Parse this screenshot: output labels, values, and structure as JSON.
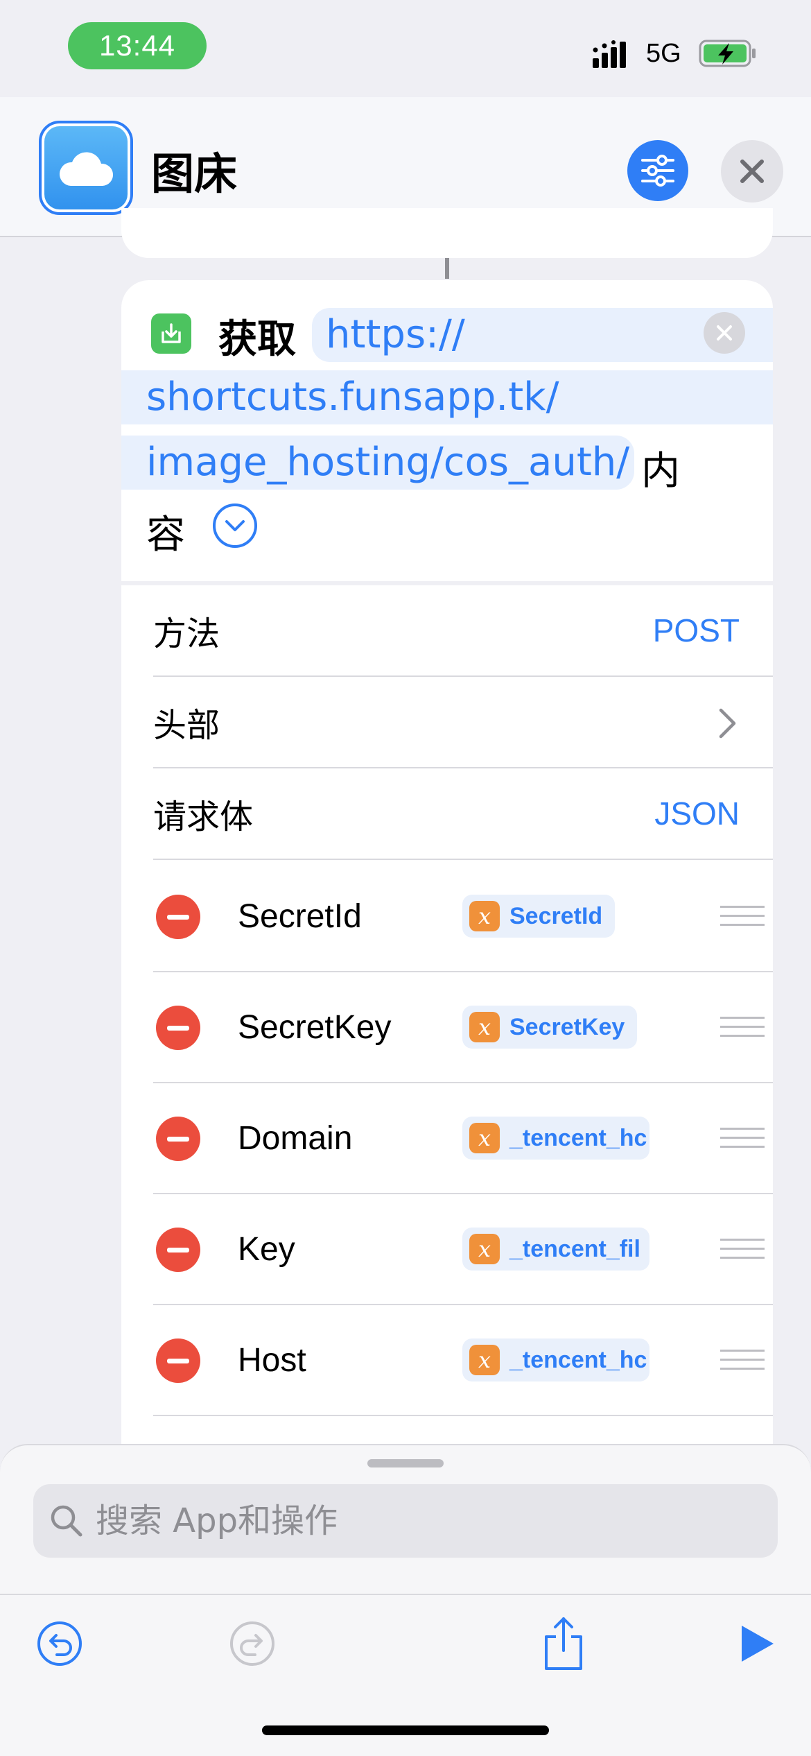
{
  "status_bar": {
    "time": "13:44",
    "network": "5G"
  },
  "header": {
    "title": "图床",
    "app_icon": "cloud-icon"
  },
  "action": {
    "verb": "获取",
    "url_line1": "https://",
    "url_line2": "shortcuts.funsapp.tk/",
    "url_line3": "image_hosting/cos_auth/",
    "suffix_part1": "内",
    "suffix_part2": "容"
  },
  "rows": {
    "method": {
      "label": "方法",
      "value": "POST"
    },
    "headers": {
      "label": "头部"
    },
    "body": {
      "label": "请求体",
      "value": "JSON"
    }
  },
  "fields": [
    {
      "key": "SecretId",
      "variable": "SecretId"
    },
    {
      "key": "SecretKey",
      "variable": "SecretKey"
    },
    {
      "key": "Domain",
      "variable": "_tencent_hc"
    },
    {
      "key": "Key",
      "variable": "_tencent_fil"
    },
    {
      "key": "Host",
      "variable": "_tencent_hc"
    }
  ],
  "variable_badge": "x",
  "search": {
    "placeholder": "搜索 App和操作"
  },
  "colors": {
    "accent": "#2f7ef6",
    "remove": "#eb4d3d",
    "variable": "#f0913a",
    "action": "#4cc35f"
  }
}
